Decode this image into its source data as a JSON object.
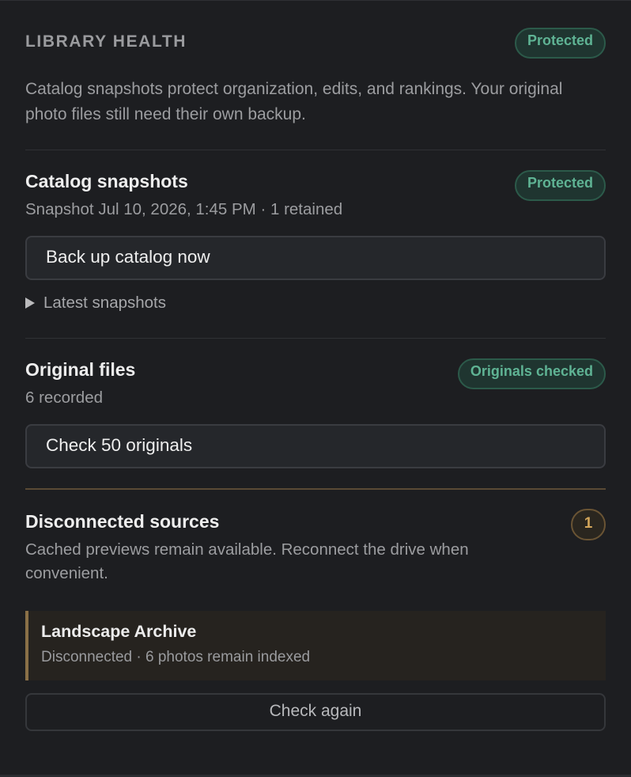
{
  "library_health": {
    "title": "LIBRARY HEALTH",
    "status": "Protected",
    "description": "Catalog snapshots protect organization, edits, and rankings. Your original photo files still need their own backup."
  },
  "catalog": {
    "title": "Catalog snapshots",
    "status": "Protected",
    "subtitle": "Snapshot Jul 10, 2026, 1:45 PM · 1 retained",
    "backup_button": "Back up catalog now",
    "latest_snapshots": "Latest snapshots"
  },
  "originals": {
    "title": "Original files",
    "status": "Originals checked",
    "subtitle": "6 recorded",
    "check_button": "Check 50 originals"
  },
  "disconnected": {
    "title": "Disconnected sources",
    "count": "1",
    "description": "Cached previews remain available. Reconnect the drive when convenient.",
    "sources": [
      {
        "name": "Landscape Archive",
        "status": "Disconnected · 6 photos remain indexed"
      }
    ],
    "check_again_button": "Check again"
  },
  "colors": {
    "background": "#1d1e21",
    "protected_green": "#5fb394",
    "warning_amber": "#d2a55a"
  },
  "icons": {
    "disclosure": "triangle-right-icon"
  }
}
